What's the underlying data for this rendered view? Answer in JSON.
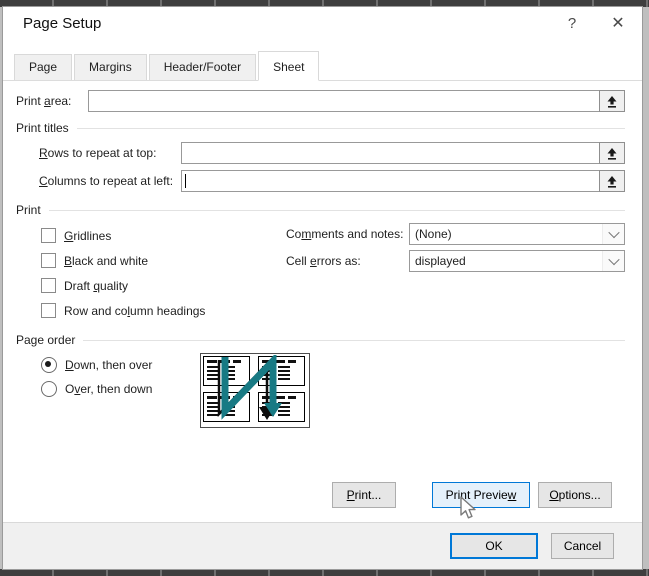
{
  "window": {
    "title": "Page Setup"
  },
  "icons": {
    "help_glyph": "?",
    "close_glyph": "✕",
    "collapse": "collapse-dialog-icon",
    "chevron": "chevron-down-icon",
    "cursor": "arrow-pointer"
  },
  "tabs": [
    {
      "label": "Page",
      "active": false
    },
    {
      "label": "Margins",
      "active": false
    },
    {
      "label": "Header/Footer",
      "active": false
    },
    {
      "label": "Sheet",
      "active": true
    }
  ],
  "fields": {
    "print_area": {
      "label": {
        "pre": "Print ",
        "key": "a",
        "post": "rea:"
      },
      "value": ""
    },
    "rows_top": {
      "label": {
        "pre": "",
        "key": "R",
        "post": "ows to repeat at top:"
      },
      "value": "",
      "focused": false
    },
    "cols_left": {
      "label": {
        "pre": "",
        "key": "C",
        "post": "olumns to repeat at left:"
      },
      "value": "",
      "focused": true
    }
  },
  "groups": {
    "print_titles": "Print titles",
    "print": "Print",
    "page_order": "Page order"
  },
  "checkboxes": [
    {
      "pre": "",
      "key": "G",
      "post": "ridlines",
      "checked": false
    },
    {
      "pre": "",
      "key": "B",
      "post": "lack and white",
      "checked": false
    },
    {
      "pre": "Draft ",
      "key": "q",
      "post": "uality",
      "checked": false
    },
    {
      "pre": "Row and co",
      "key": "l",
      "post": "umn headings",
      "checked": false
    }
  ],
  "dropdowns": {
    "comments": {
      "label": {
        "pre": "Co",
        "key": "m",
        "post": "ments and notes:"
      },
      "value": "(None)"
    },
    "cell_errors": {
      "label": {
        "pre": "Cell ",
        "key": "e",
        "post": "rrors as:"
      },
      "value": "displayed"
    }
  },
  "radios": [
    {
      "pre": "",
      "key": "D",
      "post": "own, then over",
      "checked": true
    },
    {
      "pre": "O",
      "key": "v",
      "post": "er, then down",
      "checked": false
    }
  ],
  "buttons": {
    "print": {
      "pre": "",
      "key": "P",
      "post": "rint..."
    },
    "print_preview": {
      "pre": "Print Previe",
      "key": "w",
      "post": ""
    },
    "options": {
      "pre": "",
      "key": "O",
      "post": "ptions..."
    },
    "ok_label": "OK",
    "cancel_label": "Cancel"
  },
  "colors": {
    "accent": "#0078d7",
    "accent_hover_bg": "#e5f1fb",
    "teal_arrow": "#187a84",
    "button_bg": "#e6e6e6",
    "button_border": "#adadad",
    "footer_bg": "#f0f0f0",
    "field_border": "#999999"
  }
}
